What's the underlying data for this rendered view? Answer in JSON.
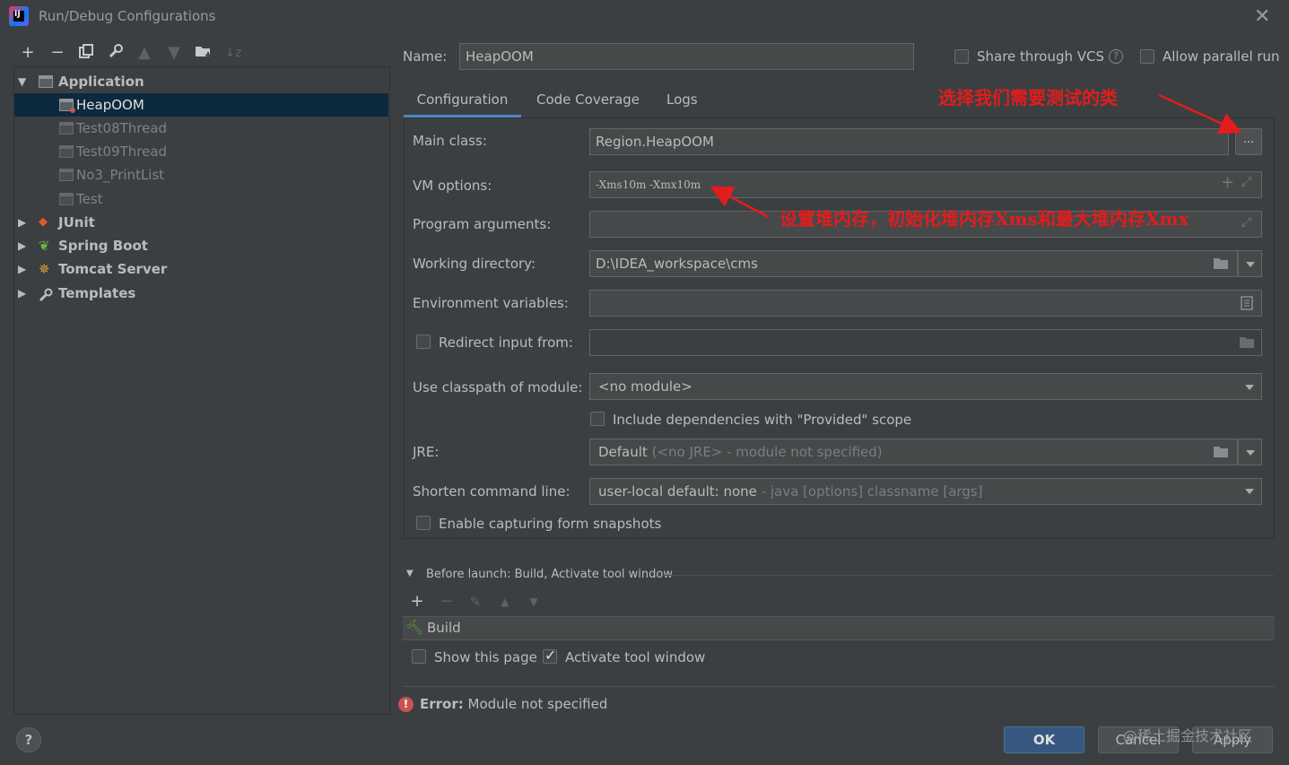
{
  "window": {
    "title": "Run/Debug Configurations",
    "app_icon_text": "IJ"
  },
  "toolbar": {
    "icons": [
      "add-icon",
      "remove-icon",
      "copy-icon",
      "wrench-icon",
      "move-up-icon",
      "move-down-icon",
      "new-folder-icon",
      "sort-icon"
    ]
  },
  "tree": {
    "items": [
      {
        "label": "Application",
        "level": 0,
        "expanded": true,
        "bold": true
      },
      {
        "label": "HeapOOM",
        "level": 1,
        "selected": true
      },
      {
        "label": "Test08Thread",
        "level": 1
      },
      {
        "label": "Test09Thread",
        "level": 1
      },
      {
        "label": "No3_PrintList",
        "level": 1
      },
      {
        "label": "Test",
        "level": 1
      },
      {
        "label": "JUnit",
        "level": 0,
        "bold": true
      },
      {
        "label": "Spring Boot",
        "level": 0,
        "bold": true
      },
      {
        "label": "Tomcat Server",
        "level": 0,
        "bold": true
      },
      {
        "label": "Templates",
        "level": 0,
        "bold": true
      }
    ]
  },
  "header": {
    "name_label": "Name:",
    "name_value": "HeapOOM",
    "share_vcs_label": "Share through VCS",
    "share_vcs_checked": false,
    "help_glyph": "?",
    "parallel_label": "Allow parallel run",
    "parallel_checked": false
  },
  "tabs": [
    {
      "label": "Configuration",
      "active": true
    },
    {
      "label": "Code Coverage",
      "active": false
    },
    {
      "label": "Logs",
      "active": false
    }
  ],
  "form": {
    "main_class": {
      "label": "Main class:",
      "value": "Region.HeapOOM",
      "browse": "..."
    },
    "vm_options": {
      "label": "VM options:",
      "value": "-Xms10m -Xmx10m"
    },
    "program_arguments": {
      "label": "Program arguments:",
      "value": ""
    },
    "working_directory": {
      "label": "Working directory:",
      "value": "D:\\IDEA_workspace\\cms"
    },
    "environment_variables": {
      "label": "Environment variables:",
      "value": ""
    },
    "redirect_input": {
      "label": "Redirect input from:",
      "checked": false,
      "value": ""
    },
    "classpath_module": {
      "label": "Use classpath of module:",
      "value": "<no module>"
    },
    "include_provided": {
      "label": "Include dependencies with \"Provided\" scope",
      "checked": false
    },
    "jre": {
      "label": "JRE:",
      "value": "Default",
      "hint": "(<no JRE> - module not specified)"
    },
    "shorten_cmd": {
      "label": "Shorten command line:",
      "value": "user-local default: none",
      "hint": "- java [options] classname [args]"
    },
    "capture_snapshots": {
      "label": "Enable capturing form snapshots",
      "checked": false
    }
  },
  "before_launch": {
    "title": "Before launch: Build, Activate tool window",
    "task": "Build",
    "show_page": {
      "label": "Show this page",
      "checked": false
    },
    "activate_window": {
      "label": "Activate tool window",
      "checked": true
    }
  },
  "error": {
    "prefix": "Error:",
    "message": "Module not specified"
  },
  "buttons": {
    "ok": "OK",
    "cancel": "Cancel",
    "apply": "Apply",
    "help": "?"
  },
  "annotations": {
    "select_class": "选择我们需要测试的类",
    "heap_setting": "设置堆内存，初始化堆内存Xms和最大堆内存Xmx"
  },
  "watermark": "@稀土掘金技术社区",
  "colors": {
    "background": "#3c3f41",
    "selection": "#0d293e",
    "accent": "#4a88c7",
    "error": "#c75450",
    "annotation": "#e31c1c"
  }
}
